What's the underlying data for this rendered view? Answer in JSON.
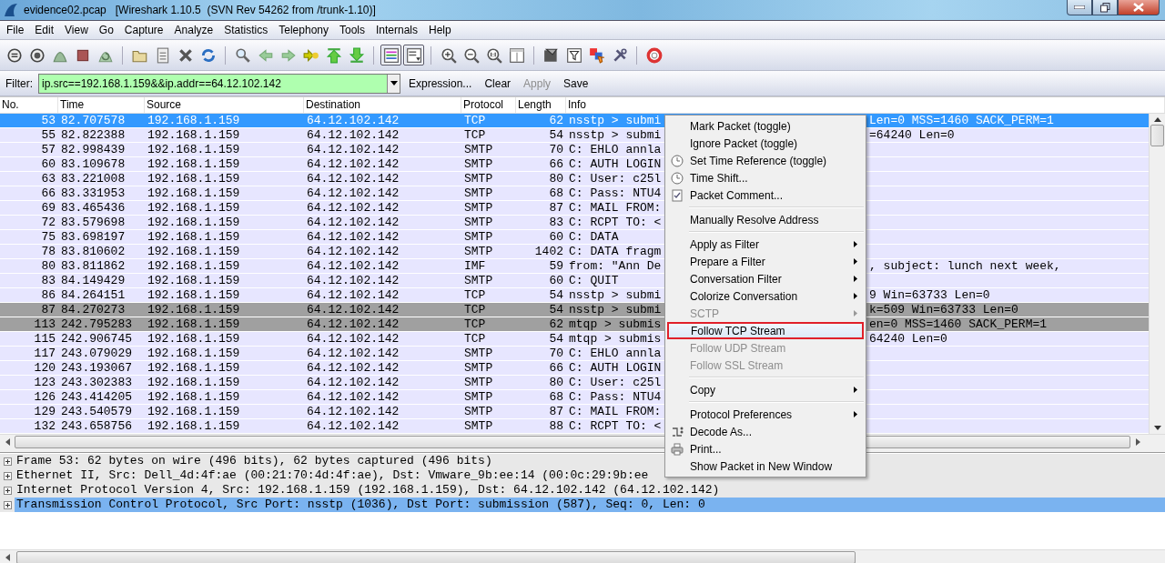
{
  "window": {
    "title": "evidence02.pcap   [Wireshark 1.10.5  (SVN Rev 54262 from /trunk-1.10)]"
  },
  "menubar": [
    "File",
    "Edit",
    "View",
    "Go",
    "Capture",
    "Analyze",
    "Statistics",
    "Telephony",
    "Tools",
    "Internals",
    "Help"
  ],
  "toolbar": [
    {
      "kind": "interfaces",
      "pressed": false
    },
    {
      "kind": "options",
      "pressed": false
    },
    {
      "kind": "start",
      "pressed": false
    },
    {
      "kind": "stop",
      "pressed": false
    },
    {
      "kind": "restart",
      "pressed": false
    },
    {
      "kind": "separator"
    },
    {
      "kind": "open",
      "pressed": false
    },
    {
      "kind": "save",
      "pressed": false
    },
    {
      "kind": "close",
      "pressed": false
    },
    {
      "kind": "reload",
      "pressed": false
    },
    {
      "kind": "separator"
    },
    {
      "kind": "find",
      "pressed": false
    },
    {
      "kind": "back",
      "pressed": false
    },
    {
      "kind": "forward",
      "pressed": false
    },
    {
      "kind": "goto",
      "pressed": false
    },
    {
      "kind": "first",
      "pressed": false
    },
    {
      "kind": "last",
      "pressed": false
    },
    {
      "kind": "separator"
    },
    {
      "kind": "colorize",
      "pressed": true
    },
    {
      "kind": "autoscroll",
      "pressed": true
    },
    {
      "kind": "separator"
    },
    {
      "kind": "zoom-in",
      "pressed": false
    },
    {
      "kind": "zoom-out",
      "pressed": false
    },
    {
      "kind": "zoom-normal",
      "pressed": false
    },
    {
      "kind": "resize",
      "pressed": false
    },
    {
      "kind": "separator"
    },
    {
      "kind": "capture-filter",
      "pressed": false
    },
    {
      "kind": "display-filter",
      "pressed": false
    },
    {
      "kind": "coloring",
      "pressed": false
    },
    {
      "kind": "preferences",
      "pressed": false
    },
    {
      "kind": "separator"
    },
    {
      "kind": "help",
      "pressed": false
    }
  ],
  "filter": {
    "label": "Filter:",
    "value": "ip.src==192.168.1.159&&ip.addr==64.12.102.142",
    "actions": [
      {
        "label": "Expression...",
        "disabled": false
      },
      {
        "label": "Clear",
        "disabled": false
      },
      {
        "label": "Apply",
        "disabled": true
      },
      {
        "label": "Save",
        "disabled": false
      }
    ]
  },
  "packet_list": {
    "columns": [
      "No.",
      "Time",
      "Source",
      "Destination",
      "Protocol",
      "Length",
      "Info"
    ],
    "rows": [
      {
        "no": "53",
        "time": "82.707578",
        "source": "192.168.1.159",
        "destination": "64.12.102.142",
        "protocol": "TCP",
        "length": "62",
        "info": "nsstp > submi",
        "info_after_menu": "Len=0 MSS=1460 SACK_PERM=1",
        "selected": true
      },
      {
        "no": "55",
        "time": "82.822388",
        "source": "192.168.1.159",
        "destination": "64.12.102.142",
        "protocol": "TCP",
        "length": "54",
        "info": "nsstp > submi",
        "info_after_menu": "=64240 Len=0",
        "selected": false,
        "color": "#e7e6ff"
      },
      {
        "no": "57",
        "time": "82.998439",
        "source": "192.168.1.159",
        "destination": "64.12.102.142",
        "protocol": "SMTP",
        "length": "70",
        "info": "C: EHLO annla",
        "selected": false,
        "color": "#e7e6ff"
      },
      {
        "no": "60",
        "time": "83.109678",
        "source": "192.168.1.159",
        "destination": "64.12.102.142",
        "protocol": "SMTP",
        "length": "66",
        "info": "C: AUTH LOGIN",
        "selected": false,
        "color": "#e7e6ff"
      },
      {
        "no": "63",
        "time": "83.221008",
        "source": "192.168.1.159",
        "destination": "64.12.102.142",
        "protocol": "SMTP",
        "length": "80",
        "info": "C: User: c25l",
        "selected": false,
        "color": "#e7e6ff"
      },
      {
        "no": "66",
        "time": "83.331953",
        "source": "192.168.1.159",
        "destination": "64.12.102.142",
        "protocol": "SMTP",
        "length": "68",
        "info": "C: Pass: NTU4",
        "selected": false,
        "color": "#e7e6ff"
      },
      {
        "no": "69",
        "time": "83.465436",
        "source": "192.168.1.159",
        "destination": "64.12.102.142",
        "protocol": "SMTP",
        "length": "87",
        "info": "C: MAIL FROM:",
        "selected": false,
        "color": "#e7e6ff"
      },
      {
        "no": "72",
        "time": "83.579698",
        "source": "192.168.1.159",
        "destination": "64.12.102.142",
        "protocol": "SMTP",
        "length": "83",
        "info": "C: RCPT TO: <",
        "selected": false,
        "color": "#e7e6ff"
      },
      {
        "no": "75",
        "time": "83.698197",
        "source": "192.168.1.159",
        "destination": "64.12.102.142",
        "protocol": "SMTP",
        "length": "60",
        "info": "C: DATA",
        "selected": false,
        "color": "#e7e6ff"
      },
      {
        "no": "78",
        "time": "83.810602",
        "source": "192.168.1.159",
        "destination": "64.12.102.142",
        "protocol": "SMTP",
        "length": "1402",
        "info": "C: DATA fragm",
        "selected": false,
        "color": "#e7e6ff"
      },
      {
        "no": "80",
        "time": "83.811862",
        "source": "192.168.1.159",
        "destination": "64.12.102.142",
        "protocol": "IMF",
        "length": "59",
        "info": "from: \"Ann De",
        "info_after_menu": ", subject: lunch next week,",
        "selected": false,
        "color": "#e7e6ff"
      },
      {
        "no": "83",
        "time": "84.149429",
        "source": "192.168.1.159",
        "destination": "64.12.102.142",
        "protocol": "SMTP",
        "length": "60",
        "info": "C: QUIT",
        "selected": false,
        "color": "#e7e6ff"
      },
      {
        "no": "86",
        "time": "84.264151",
        "source": "192.168.1.159",
        "destination": "64.12.102.142",
        "protocol": "TCP",
        "length": "54",
        "info": "nsstp > submi",
        "info_after_menu": "9 Win=63733 Len=0",
        "selected": false,
        "color": "#e7e6ff"
      },
      {
        "no": "87",
        "time": "84.270273",
        "source": "192.168.1.159",
        "destination": "64.12.102.142",
        "protocol": "TCP",
        "length": "54",
        "info": "nsstp > submi",
        "info_after_menu": "k=509 Win=63733 Len=0",
        "selected": false,
        "color": "#a0a0a0"
      },
      {
        "no": "113",
        "time": "242.795283",
        "source": "192.168.1.159",
        "destination": "64.12.102.142",
        "protocol": "TCP",
        "length": "62",
        "info": "mtqp > submis",
        "info_after_menu": "en=0 MSS=1460 SACK_PERM=1",
        "selected": false,
        "color": "#a0a0a0"
      },
      {
        "no": "115",
        "time": "242.906745",
        "source": "192.168.1.159",
        "destination": "64.12.102.142",
        "protocol": "TCP",
        "length": "54",
        "info": "mtqp > submis",
        "info_after_menu": "64240 Len=0",
        "selected": false,
        "color": "#e7e6ff"
      },
      {
        "no": "117",
        "time": "243.079029",
        "source": "192.168.1.159",
        "destination": "64.12.102.142",
        "protocol": "SMTP",
        "length": "70",
        "info": "C: EHLO annla",
        "selected": false,
        "color": "#e7e6ff"
      },
      {
        "no": "120",
        "time": "243.193067",
        "source": "192.168.1.159",
        "destination": "64.12.102.142",
        "protocol": "SMTP",
        "length": "66",
        "info": "C: AUTH LOGIN",
        "selected": false,
        "color": "#e7e6ff"
      },
      {
        "no": "123",
        "time": "243.302383",
        "source": "192.168.1.159",
        "destination": "64.12.102.142",
        "protocol": "SMTP",
        "length": "80",
        "info": "C: User: c25l",
        "selected": false,
        "color": "#e7e6ff"
      },
      {
        "no": "126",
        "time": "243.414205",
        "source": "192.168.1.159",
        "destination": "64.12.102.142",
        "protocol": "SMTP",
        "length": "68",
        "info": "C: Pass: NTU4",
        "selected": false,
        "color": "#e7e6ff"
      },
      {
        "no": "129",
        "time": "243.540579",
        "source": "192.168.1.159",
        "destination": "64.12.102.142",
        "protocol": "SMTP",
        "length": "87",
        "info": "C: MAIL FROM:",
        "selected": false,
        "color": "#e7e6ff"
      },
      {
        "no": "132",
        "time": "243.658756",
        "source": "192.168.1.159",
        "destination": "64.12.102.142",
        "protocol": "SMTP",
        "length": "88",
        "info": "C: RCPT TO: <",
        "selected": false,
        "color": "#e7e6ff"
      }
    ]
  },
  "details": [
    {
      "text": "Frame 53: 62 bytes on wire (496 bits), 62 bytes captured (496 bits)",
      "expanded": false,
      "selected": false
    },
    {
      "text": "Ethernet II, Src: Dell_4d:4f:ae (00:21:70:4d:4f:ae), Dst: Vmware_9b:ee:14 (00:0c:29:9b:ee",
      "expanded": false,
      "selected": false
    },
    {
      "text": "Internet Protocol Version 4, Src: 192.168.1.159 (192.168.1.159), Dst: 64.12.102.142 (64.12.102.142)",
      "expanded": false,
      "selected": false
    },
    {
      "text": "Transmission Control Protocol, Src Port: nsstp (1036), Dst Port: submission (587), Seq: 0, Len: 0",
      "expanded": false,
      "selected": true
    }
  ],
  "context_menu": [
    {
      "kind": "item",
      "label": "Mark Packet (toggle)",
      "submenu": false,
      "disabled": false,
      "highlighted": false
    },
    {
      "kind": "item",
      "label": "Ignore Packet (toggle)",
      "submenu": false,
      "disabled": false,
      "highlighted": false
    },
    {
      "kind": "clock",
      "label": "Set Time Reference (toggle)",
      "submenu": false,
      "disabled": false,
      "highlighted": false
    },
    {
      "kind": "clock",
      "label": "Time Shift...",
      "submenu": false,
      "disabled": false,
      "highlighted": false
    },
    {
      "kind": "note",
      "label": "Packet Comment...",
      "submenu": false,
      "disabled": false,
      "highlighted": false
    },
    {
      "kind": "separator"
    },
    {
      "kind": "item",
      "label": "Manually Resolve Address",
      "submenu": false,
      "disabled": false,
      "highlighted": false
    },
    {
      "kind": "separator"
    },
    {
      "kind": "item",
      "label": "Apply as Filter",
      "submenu": true,
      "disabled": false,
      "highlighted": false
    },
    {
      "kind": "item",
      "label": "Prepare a Filter",
      "submenu": true,
      "disabled": false,
      "highlighted": false
    },
    {
      "kind": "item",
      "label": "Conversation Filter",
      "submenu": true,
      "disabled": false,
      "highlighted": false
    },
    {
      "kind": "item",
      "label": "Colorize Conversation",
      "submenu": true,
      "disabled": false,
      "highlighted": false
    },
    {
      "kind": "item",
      "label": "SCTP",
      "submenu": true,
      "disabled": true,
      "highlighted": false
    },
    {
      "kind": "item",
      "label": "Follow TCP Stream",
      "submenu": false,
      "disabled": false,
      "highlighted": true
    },
    {
      "kind": "item",
      "label": "Follow UDP Stream",
      "submenu": false,
      "disabled": true,
      "highlighted": false
    },
    {
      "kind": "item",
      "label": "Follow SSL Stream",
      "submenu": false,
      "disabled": true,
      "highlighted": false
    },
    {
      "kind": "separator"
    },
    {
      "kind": "item",
      "label": "Copy",
      "submenu": true,
      "disabled": false,
      "highlighted": false
    },
    {
      "kind": "separator"
    },
    {
      "kind": "item",
      "label": "Protocol Preferences",
      "submenu": true,
      "disabled": false,
      "highlighted": false
    },
    {
      "kind": "decode",
      "label": "Decode As...",
      "submenu": false,
      "disabled": false,
      "highlighted": false
    },
    {
      "kind": "printer",
      "label": "Print...",
      "submenu": false,
      "disabled": false,
      "highlighted": false
    },
    {
      "kind": "item",
      "label": "Show Packet in New Window",
      "submenu": false,
      "disabled": false,
      "highlighted": false
    }
  ]
}
